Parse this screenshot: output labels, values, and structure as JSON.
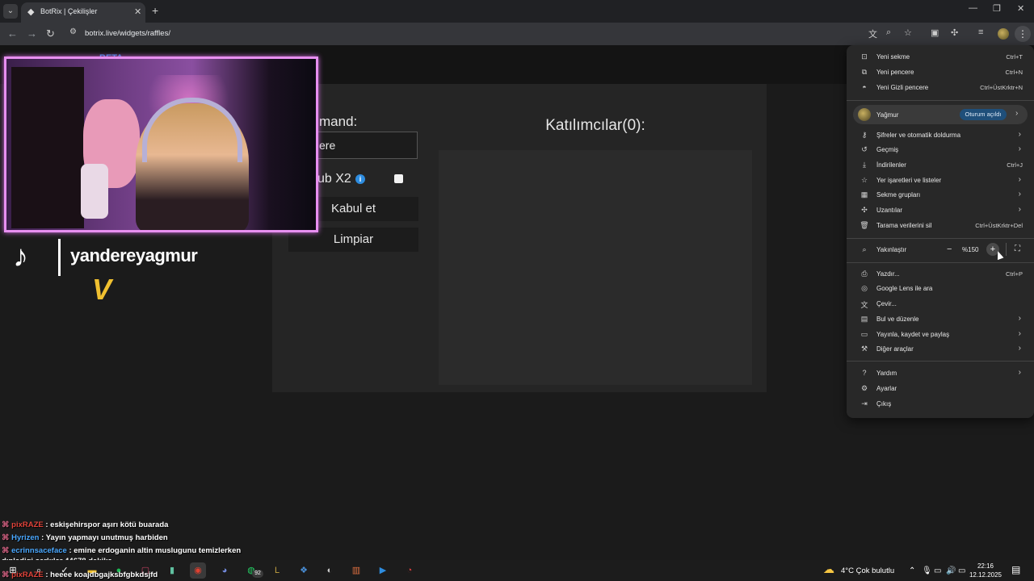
{
  "browser": {
    "tab_title": "BotRix | Çekilişler",
    "url": "botrix.live/widgets/raffles/"
  },
  "page": {
    "beta_label": "BETA",
    "command_label": "mand:",
    "command_value": "ere",
    "sub_label": "ub X2",
    "accept_button": "Kabul et",
    "clear_button": "Limpiar",
    "participants_title": "Katılımcılar(0):"
  },
  "overlay": {
    "username": "yandereyagmur"
  },
  "chat": [
    {
      "user": "pixRAZE",
      "message": " : eskişehirspor aşırı kötü buarada",
      "color": "user-red"
    },
    {
      "user": "Hyrizen",
      "message": " : Yayın yapmayı unutmuş harbiden",
      "color": "user-blue"
    },
    {
      "user": "ecrinnsaceface",
      "message": " : emine erdoganin altin muslugunu temizlerken",
      "color": "user-blue"
    },
    {
      "user": "",
      "message": "dınledigi sarkılar 44678 dakika",
      "color": ""
    },
    {
      "user": "pixRAZE",
      "message": " : heeee koajdbgajksbfgbkdsjfd",
      "color": "user-red"
    }
  ],
  "menu": {
    "items_top": [
      {
        "label": "Yeni sekme",
        "shortcut": "Ctrl+T",
        "icon": "new-tab-icon"
      },
      {
        "label": "Yeni pencere",
        "shortcut": "Ctrl+N",
        "icon": "new-window-icon"
      },
      {
        "label": "Yeni Gizli pencere",
        "shortcut": "Ctrl+ÜstKrktr+N",
        "icon": "incognito-icon"
      }
    ],
    "profile_name": "Yağmur",
    "profile_status": "Oturum açıldı",
    "items_mid": [
      {
        "label": "Şifreler ve otomatik doldurma",
        "shortcut": "",
        "icon": "key-icon"
      },
      {
        "label": "Geçmiş",
        "shortcut": "",
        "icon": "history-icon"
      },
      {
        "label": "İndirilenler",
        "shortcut": "Ctrl+J",
        "icon": "download-icon"
      },
      {
        "label": "Yer işaretleri ve listeler",
        "shortcut": "",
        "icon": "star-icon"
      },
      {
        "label": "Sekme grupları",
        "shortcut": "",
        "icon": "tab-groups-icon"
      },
      {
        "label": "Uzantılar",
        "shortcut": "",
        "icon": "extensions-icon"
      },
      {
        "label": "Tarama verilerini sil",
        "shortcut": "Ctrl+ÜstKrktr+Del",
        "icon": "trash-icon"
      }
    ],
    "zoom_label": "Yakınlaştır",
    "zoom_value": "%150",
    "items_tools": [
      {
        "label": "Yazdır...",
        "shortcut": "Ctrl+P",
        "icon": "print-icon"
      },
      {
        "label": "Google Lens ile ara",
        "shortcut": "",
        "icon": "lens-icon"
      },
      {
        "label": "Çevir...",
        "shortcut": "",
        "icon": "translate-icon"
      },
      {
        "label": "Bul ve düzenle",
        "shortcut": "",
        "icon": "find-icon"
      },
      {
        "label": "Yayınla, kaydet ve paylaş",
        "shortcut": "",
        "icon": "cast-icon"
      },
      {
        "label": "Diğer araçlar",
        "shortcut": "",
        "icon": "tools-icon"
      }
    ],
    "items_bottom": [
      {
        "label": "Yardım",
        "shortcut": "",
        "icon": "help-icon"
      },
      {
        "label": "Ayarlar",
        "shortcut": "",
        "icon": "settings-icon"
      },
      {
        "label": "Çıkış",
        "shortcut": "",
        "icon": "exit-icon"
      }
    ]
  },
  "taskbar": {
    "badge_count": "92",
    "weather": "4°C  Çok bulutlu",
    "time": "22:16",
    "date": "12.12.2025",
    "notif_count": "4"
  }
}
